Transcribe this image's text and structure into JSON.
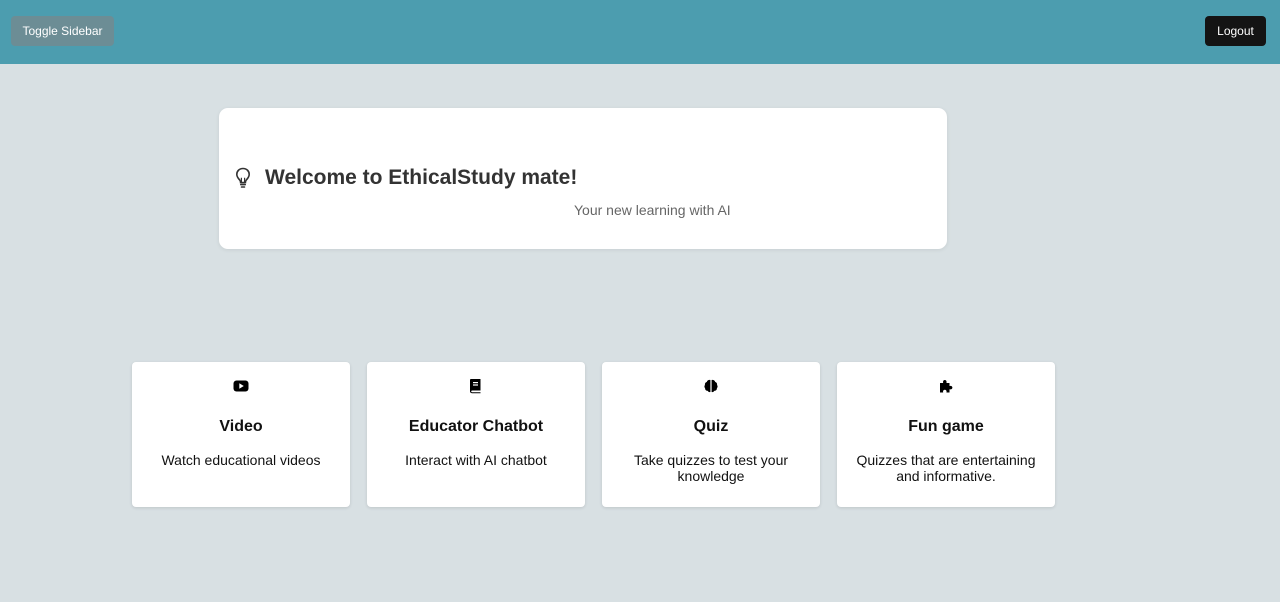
{
  "header": {
    "toggle_label": "Toggle Sidebar",
    "logout_label": "Logout",
    "background": "#4c9daf"
  },
  "welcome": {
    "icon": "lightbulb-icon",
    "title": "Welcome to EthicalStudy mate!",
    "subtitle": "Your new learning with AI"
  },
  "features": [
    {
      "icon": "youtube-icon",
      "title": "Video",
      "description": "Watch educational videos"
    },
    {
      "icon": "book-icon",
      "title": "Educator Chatbot",
      "description": "Interact with AI chatbot"
    },
    {
      "icon": "brain-icon",
      "title": "Quiz",
      "description": "Take quizzes to test your knowledge"
    },
    {
      "icon": "puzzle-icon",
      "title": "Fun game",
      "description": "Quizzes that are entertaining and informative."
    }
  ]
}
